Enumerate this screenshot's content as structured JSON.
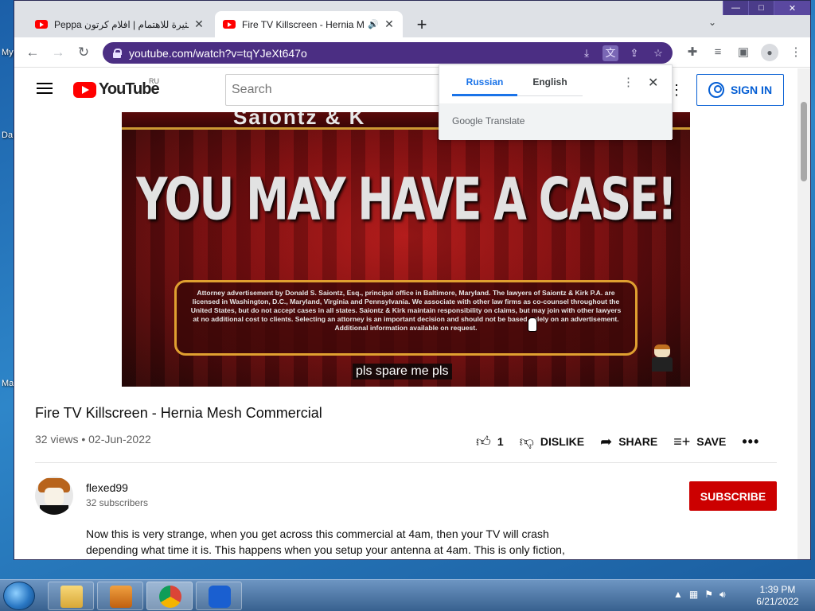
{
  "desktop": {
    "labels": [
      "My",
      "Da",
      "Ma"
    ]
  },
  "browser": {
    "tabs": [
      {
        "title": "Peppa حلقات مثيرة للاهتمام | افلام كرتون",
        "active": false
      },
      {
        "title": "Fire TV Killscreen - Hernia Me",
        "active": true
      }
    ],
    "new_tab_icon": "+",
    "tab_search_icon": "⌄",
    "url": "youtube.com/watch?v=tqYJeXt647o",
    "window_controls": {
      "minimize": "—",
      "maximize": "□",
      "close": "✕"
    }
  },
  "youtube": {
    "logo_text": "YouTube",
    "region": "RU",
    "search_placeholder": "Search",
    "sign_in": "SIGN IN"
  },
  "translate_popup": {
    "tabs": [
      "Russian",
      "English"
    ],
    "selected": "Russian",
    "brand": "Google Translate"
  },
  "video": {
    "banner_text": "Saiontz & K",
    "headline": "YOU MAY HAVE A CASE!",
    "disclaimer": "Attorney advertisement by Donald S. Saiontz, Esq., principal office in Baltimore, Maryland. The lawyers of Saiontz & Kirk P.A. are licensed in Washington, D.C., Maryland, Virginia and Pennsylvania. We associate with other law firms as co-counsel throughout the United States, but do not accept cases in all states. Saiontz & Kirk maintain responsibility on claims, but may join with other lawyers at no additional cost to clients. Selecting an attorney is an important decision and should not be based solely on an advertisement. Additional information available on request.",
    "caption": "pls spare me pls",
    "title": "Fire TV Killscreen - Hernia Mesh Commercial",
    "meta": "32 views • 02-Jun-2022",
    "likes": "1",
    "dislike_label": "DISLIKE",
    "share_label": "SHARE",
    "save_label": "SAVE"
  },
  "channel": {
    "name": "flexed99",
    "subscribers": "32 subscribers",
    "subscribe_label": "SUBSCRIBE",
    "description": "Now this is very strange, when you get across this commercial at 4am, then your TV will crash depending what time it is. This happens when you setup your antenna at 4am. This is only fiction,"
  },
  "taskbar": {
    "time": "1:39 PM",
    "date": "6/21/2022"
  },
  "colors": {
    "omnibox": "#4b2e83",
    "subscribe": "#cc0000",
    "sign_in": "#065fd4"
  }
}
